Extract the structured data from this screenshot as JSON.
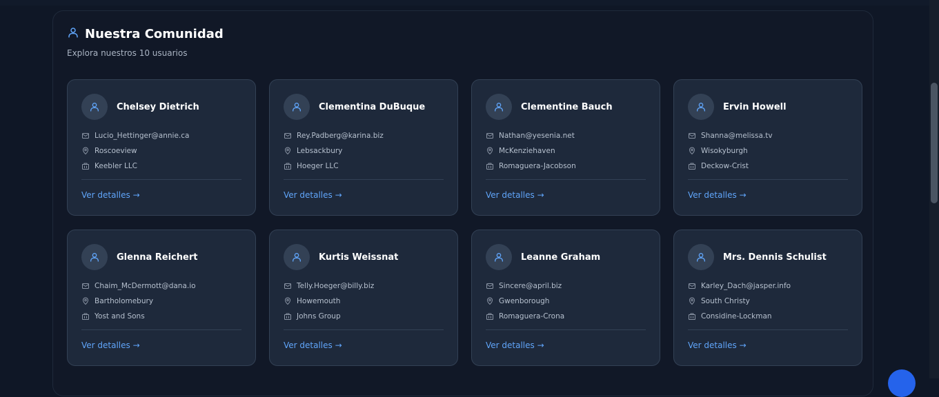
{
  "header": {
    "title": "Nuestra Comunidad",
    "subtitle": "Explora nuestros 10 usuarios",
    "icon": "user-icon"
  },
  "colors": {
    "accent": "#60a5fa",
    "card_bg": "#1e293b",
    "panel_bg": "#111827",
    "page_bg": "#0f1726",
    "fab": "#2563eb"
  },
  "users": [
    {
      "name": "Chelsey Dietrich",
      "email": "Lucio_Hettinger@annie.ca",
      "city": "Roscoeview",
      "company": "Keebler LLC",
      "link": "Ver detalles →"
    },
    {
      "name": "Clementina DuBuque",
      "email": "Rey.Padberg@karina.biz",
      "city": "Lebsackbury",
      "company": "Hoeger LLC",
      "link": "Ver detalles →"
    },
    {
      "name": "Clementine Bauch",
      "email": "Nathan@yesenia.net",
      "city": "McKenziehaven",
      "company": "Romaguera-Jacobson",
      "link": "Ver detalles →"
    },
    {
      "name": "Ervin Howell",
      "email": "Shanna@melissa.tv",
      "city": "Wisokyburgh",
      "company": "Deckow-Crist",
      "link": "Ver detalles →"
    },
    {
      "name": "Glenna Reichert",
      "email": "Chaim_McDermott@dana.io",
      "city": "Bartholomebury",
      "company": "Yost and Sons",
      "link": "Ver detalles →"
    },
    {
      "name": "Kurtis Weissnat",
      "email": "Telly.Hoeger@billy.biz",
      "city": "Howemouth",
      "company": "Johns Group",
      "link": "Ver detalles →"
    },
    {
      "name": "Leanne Graham",
      "email": "Sincere@april.biz",
      "city": "Gwenborough",
      "company": "Romaguera-Crona",
      "link": "Ver detalles →"
    },
    {
      "name": "Mrs. Dennis Schulist",
      "email": "Karley_Dach@jasper.info",
      "city": "South Christy",
      "company": "Considine-Lockman",
      "link": "Ver detalles →"
    }
  ]
}
